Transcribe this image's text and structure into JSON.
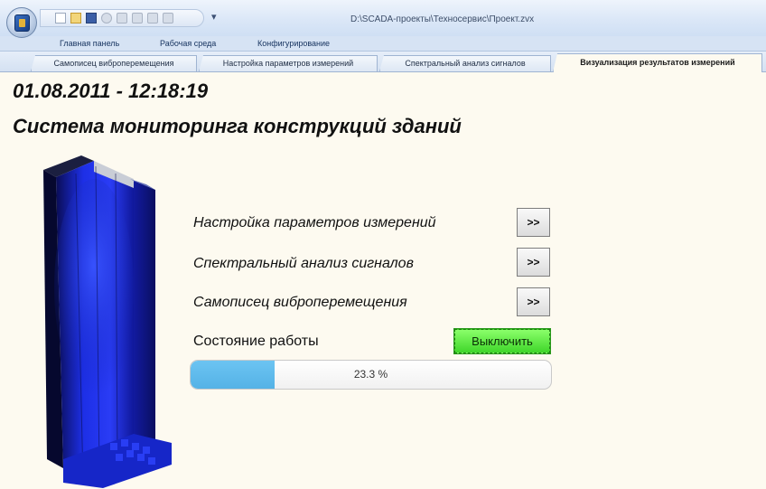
{
  "window": {
    "title": "D:\\SCADA-проекты\\Техносервис\\Проект.zvx",
    "qat_more": "▾"
  },
  "ribbon": {
    "tabs": [
      "Главная панель",
      "Рабочая среда",
      "Конфигурирование"
    ]
  },
  "doc_tabs": [
    {
      "label": "Самописец виброперемещения",
      "active": false
    },
    {
      "label": "Настройка параметров измерений",
      "active": false
    },
    {
      "label": "Спектральный анализ сигналов",
      "active": false
    },
    {
      "label": "Визуализация результатов измерений",
      "active": true
    }
  ],
  "main": {
    "datetime": "01.08.2011 - 12:18:19",
    "title": "Система мониторинга конструкций зданий",
    "nav_items": [
      {
        "label": "Настройка параметров измерений",
        "button": ">>"
      },
      {
        "label": "Спектральный анализ сигналов",
        "button": ">>"
      },
      {
        "label": "Самописец виброперемещения",
        "button": ">>"
      }
    ],
    "status_label": "Состояние работы",
    "stop_button": "Выключить",
    "progress": {
      "value_percent": 23.3,
      "text": "23.3 %"
    }
  },
  "icons": [
    "app-orb-icon",
    "new-icon",
    "open-icon",
    "save-icon",
    "undo-icon",
    "redo-icon",
    "table-icon",
    "print-icon",
    "building-model-icon"
  ],
  "colors": {
    "background": "#fdfaf0",
    "progress_fill": "#5ab8ea",
    "stop_button": "#4fe035",
    "building": "#1a2ed8"
  }
}
